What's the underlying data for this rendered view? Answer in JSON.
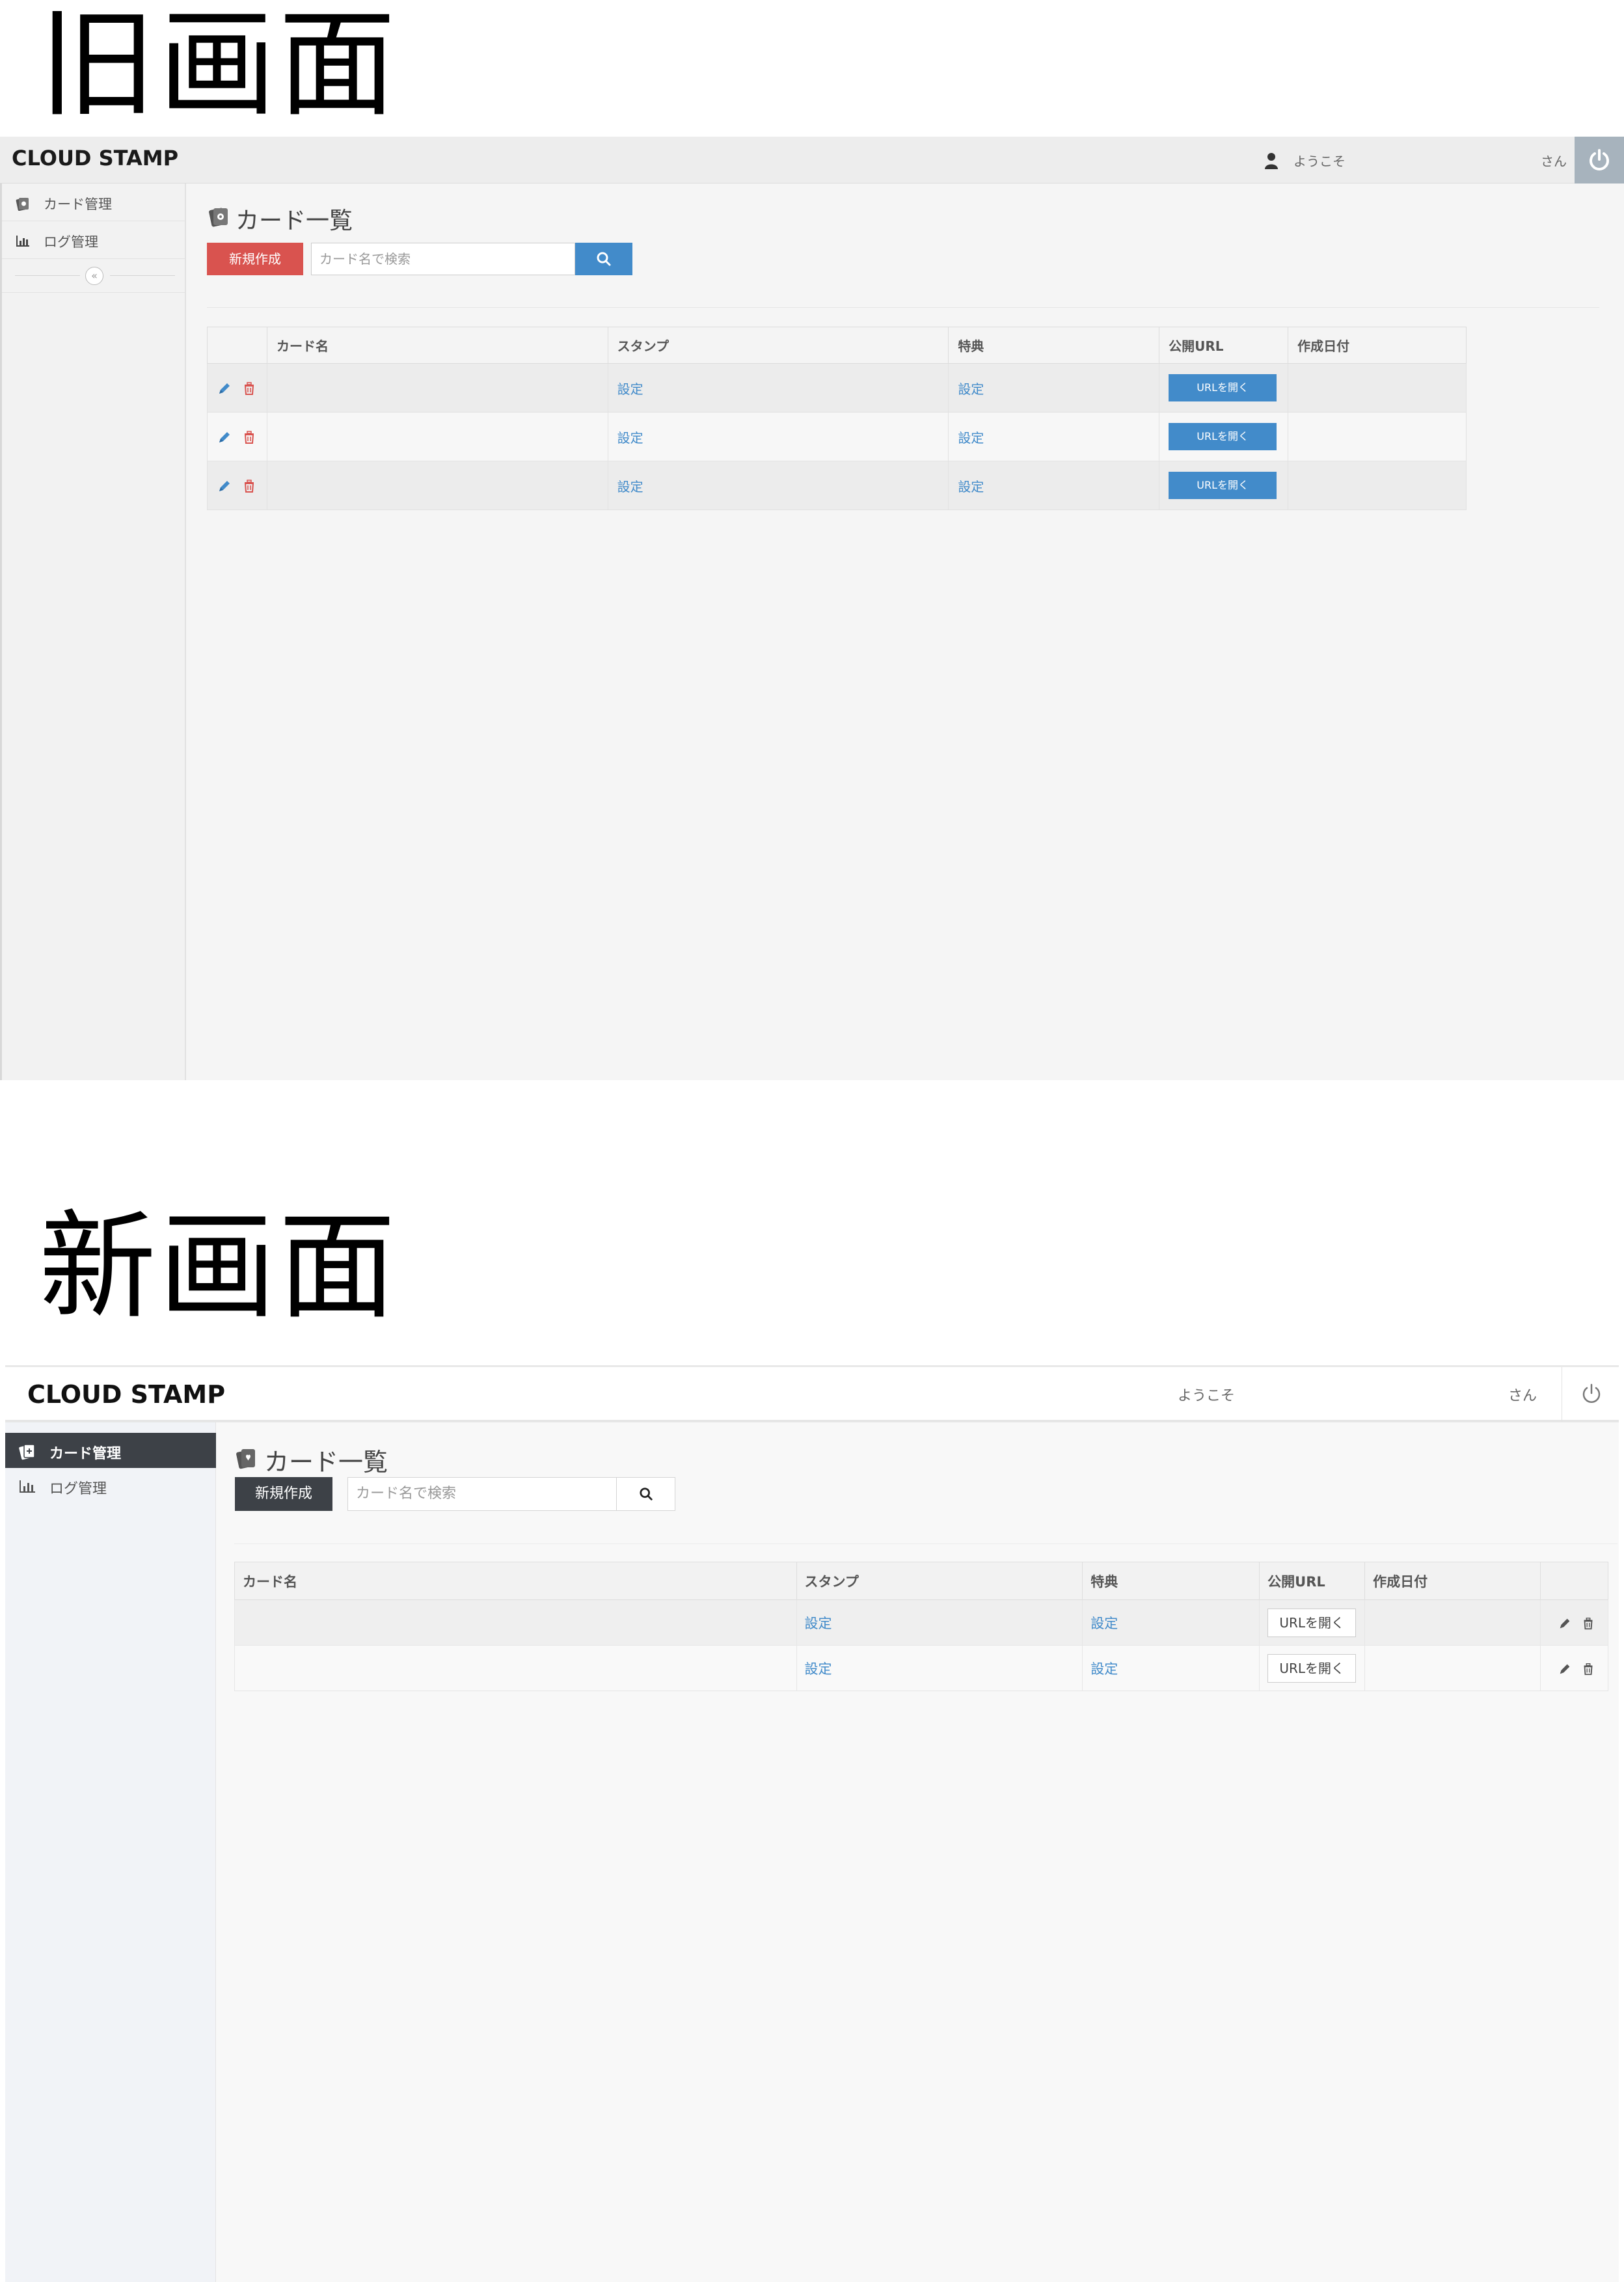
{
  "labels": {
    "old": "旧画面",
    "new": "新画面"
  },
  "app": {
    "logo": "CLOUD STAMP",
    "welcome": "ようこそ",
    "san": "さん"
  },
  "sidebar": {
    "items": [
      {
        "label": "カード管理",
        "icon": "card-icon"
      },
      {
        "label": "ログ管理",
        "icon": "bar-chart-icon"
      }
    ],
    "collapse_icon": "double-chevron-left-icon"
  },
  "page": {
    "title": "カード一覧",
    "new_button": "新規作成",
    "search_placeholder": "カード名で検索",
    "search_icon": "search-icon"
  },
  "table": {
    "headers": {
      "card_name": "カード名",
      "stamp": "スタンプ",
      "benefit": "特典",
      "public_url": "公開URL",
      "created_date": "作成日付"
    },
    "set_label": "設定",
    "url_button_old": "URLを開く",
    "url_button_new": "URLを開く"
  },
  "colors": {
    "old_primary": "#428bca",
    "old_new_button": "#d9534f",
    "new_dark": "#3d4147",
    "power_old": "#a7b3bd"
  }
}
